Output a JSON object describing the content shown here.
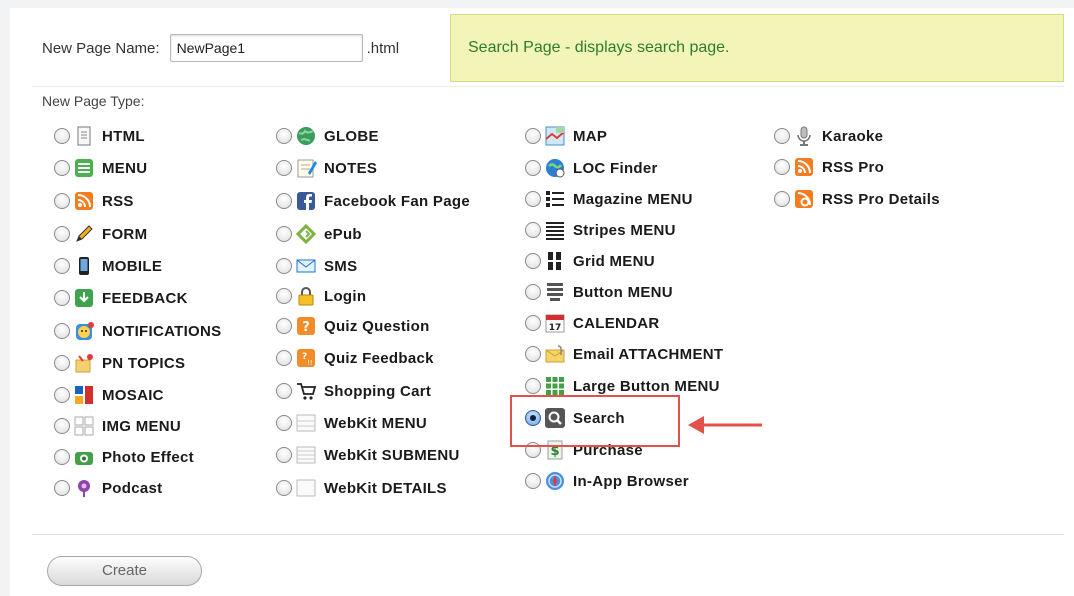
{
  "form": {
    "name_label": "New Page Name:",
    "name_value": "NewPage1",
    "extension": ".html",
    "type_label": "New Page Type:",
    "create_label": "Create"
  },
  "info": {
    "text": "Search Page - displays search page."
  },
  "columns": [
    [
      {
        "label": "HTML",
        "icon": "document-icon"
      },
      {
        "label": "MENU",
        "icon": "menu-icon"
      },
      {
        "label": "RSS",
        "icon": "rss-icon"
      },
      {
        "label": "FORM",
        "icon": "pencil-icon"
      },
      {
        "label": "MOBILE",
        "icon": "phone-icon"
      },
      {
        "label": "FEEDBACK",
        "icon": "download-arrow-icon"
      },
      {
        "label": "NOTIFICATIONS",
        "icon": "notification-icon"
      },
      {
        "label": "PN TOPICS",
        "icon": "pn-topics-icon"
      },
      {
        "label": "MOSAIC",
        "icon": "mosaic-icon"
      },
      {
        "label": "IMG MENU",
        "icon": "image-grid-icon"
      },
      {
        "label": "Photo Effect",
        "icon": "camera-icon"
      },
      {
        "label": "Podcast",
        "icon": "podcast-icon"
      }
    ],
    [
      {
        "label": "GLOBE",
        "icon": "globe-icon"
      },
      {
        "label": "NOTES",
        "icon": "notes-icon"
      },
      {
        "label": "Facebook Fan Page",
        "icon": "facebook-icon"
      },
      {
        "label": "ePub",
        "icon": "epub-icon"
      },
      {
        "label": "SMS",
        "icon": "envelope-icon"
      },
      {
        "label": "Login",
        "icon": "lock-icon"
      },
      {
        "label": "Quiz Question",
        "icon": "quiz-question-icon"
      },
      {
        "label": "Quiz Feedback",
        "icon": "quiz-feedback-icon"
      },
      {
        "label": "Shopping Cart",
        "icon": "cart-icon"
      },
      {
        "label": "WebKit MENU",
        "icon": "webkit-menu-icon"
      },
      {
        "label": "WebKit SUBMENU",
        "icon": "webkit-submenu-icon"
      },
      {
        "label": "WebKit DETAILS",
        "icon": "webkit-details-icon"
      }
    ],
    [
      {
        "label": "MAP",
        "icon": "map-icon"
      },
      {
        "label": "LOC Finder",
        "icon": "location-finder-icon"
      },
      {
        "label": "Magazine MENU",
        "icon": "magazine-list-icon"
      },
      {
        "label": "Stripes MENU",
        "icon": "stripes-icon"
      },
      {
        "label": "Grid MENU",
        "icon": "grid-icon"
      },
      {
        "label": "Button MENU",
        "icon": "button-menu-icon"
      },
      {
        "label": "CALENDAR",
        "icon": "calendar-icon"
      },
      {
        "label": "Email ATTACHMENT",
        "icon": "email-attachment-icon"
      },
      {
        "label": "Large Button MENU",
        "icon": "large-button-icon"
      },
      {
        "label": "Search",
        "icon": "search-icon",
        "selected": true
      },
      {
        "label": "Purchase",
        "icon": "dollar-icon"
      },
      {
        "label": "In-App Browser",
        "icon": "browser-icon"
      }
    ],
    [
      {
        "label": "Karaoke",
        "icon": "microphone-icon"
      },
      {
        "label": "RSS Pro",
        "icon": "rss-pro-icon"
      },
      {
        "label": "RSS Pro Details",
        "icon": "rss-pro-details-icon"
      }
    ]
  ],
  "colors": {
    "info_bg": "#f2f4b8",
    "info_text": "#2e7d2e",
    "highlight": "#e0524a"
  }
}
